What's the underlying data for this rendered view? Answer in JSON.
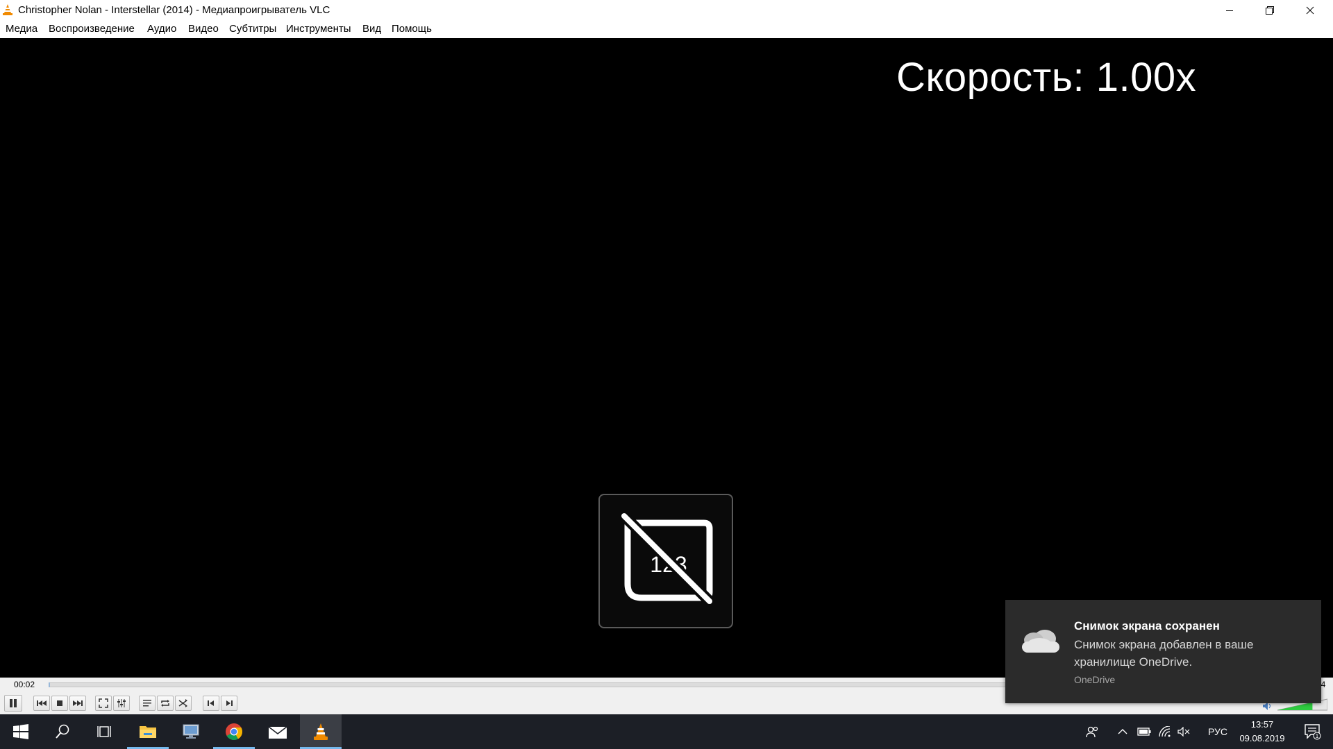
{
  "window": {
    "title": "Christopher Nolan - Interstellar (2014) - Медиапроигрыватель VLC"
  },
  "menu": [
    "Медиа",
    "Воспроизведение",
    "Аудио",
    "Видео",
    "Субтитры",
    "Инструменты",
    "Вид",
    "Помощь"
  ],
  "video": {
    "speed_osd": "Скорость: 1.00x",
    "subtitle_osd_digits": "123"
  },
  "player": {
    "time_elapsed": "00:02",
    "time_total_visible": "04",
    "progress_fraction": 0.001,
    "volume_fraction": 0.7,
    "buttons": [
      "pause",
      "previous",
      "stop",
      "next",
      "fullscreen",
      "extended-settings",
      "playlist",
      "loop",
      "random",
      "frame-prev",
      "frame-next"
    ]
  },
  "taskbar": {
    "apps": [
      "start",
      "search",
      "task-view",
      "file-explorer",
      "remote-desktop",
      "chrome",
      "mail",
      "vlc"
    ],
    "active_app": "vlc",
    "language": "РУС",
    "time": "13:57",
    "date": "09.08.2019",
    "notification_count": "1"
  },
  "toast": {
    "title": "Снимок экрана сохранен",
    "body": "Снимок экрана добавлен в ваше хранилище OneDrive.",
    "source": "OneDrive"
  },
  "colors": {
    "vlc_orange": "#f08a00",
    "volume_green": "#2ecc40",
    "taskbar": "#1c1f26",
    "toast_bg": "#2b2b2b"
  }
}
